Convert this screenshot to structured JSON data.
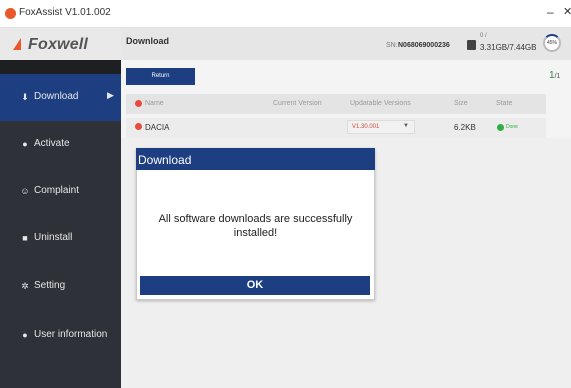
{
  "window": {
    "title": "FoxAssist V1.01.002",
    "minimize_glyph": "–",
    "close_glyph": "✕"
  },
  "header": {
    "brand": "Foxwell",
    "title": "Download",
    "sn_label": "SN:",
    "sn_value": "N068069000236",
    "storage_label": "0 /",
    "storage_value": "3.31GB/7.44GB",
    "storage_percent": "45%"
  },
  "sidebar": {
    "items": [
      {
        "label": "Download",
        "icon": "download-icon",
        "glyph": "⬇",
        "active": true
      },
      {
        "label": "Activate",
        "icon": "activate-icon",
        "glyph": "●",
        "active": false
      },
      {
        "label": "Complaint",
        "icon": "complaint-icon",
        "glyph": "☺",
        "active": false
      },
      {
        "label": "Uninstall",
        "icon": "trash-icon",
        "glyph": "■",
        "active": false
      },
      {
        "label": "Setting",
        "icon": "gear-icon",
        "glyph": "✲",
        "active": false
      },
      {
        "label": "User information",
        "icon": "user-icon",
        "glyph": "●",
        "active": false
      }
    ],
    "arrow_glyph": "▶"
  },
  "main": {
    "return_label": "Return",
    "page_current": "1",
    "page_total": "/1",
    "columns": [
      "Name",
      "Current Version",
      "Updatable Versions",
      "Size",
      "State"
    ],
    "rows": [
      {
        "name": "DACIA",
        "current_version": "",
        "updatable_version": "V1.30.001",
        "size": "6.2KB",
        "state": "Done"
      }
    ],
    "caret_glyph": "▼"
  },
  "dialog": {
    "title": "Download",
    "message": "All software downloads are successfully installed!",
    "ok_label": "OK"
  },
  "colors": {
    "accent": "#1d3f82",
    "sidebar_bg": "#2e3138",
    "brand_orange": "#e9582a",
    "status_green": "#2eae43",
    "status_red": "#e94a3b"
  }
}
